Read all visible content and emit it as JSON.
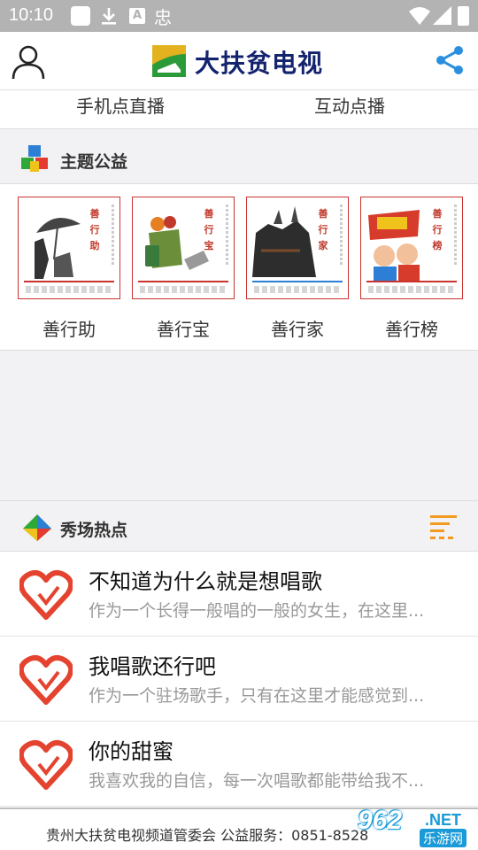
{
  "status_bar": {
    "time": "10:10",
    "badge_letter": "A",
    "app_glyph": "忠"
  },
  "header": {
    "title": "大扶贫电视",
    "accent": "#13236e",
    "share_color": "#2a8fde"
  },
  "tabs": [
    {
      "label": "手机点直播"
    },
    {
      "label": "互动点播"
    }
  ],
  "section_welfare": {
    "title": "主题公益",
    "items": [
      {
        "label": "善行助",
        "card_title": "善行助"
      },
      {
        "label": "善行宝",
        "card_title": "善行宝"
      },
      {
        "label": "善行家",
        "card_title": "善行家"
      },
      {
        "label": "善行榜",
        "card_title": "善行榜"
      }
    ]
  },
  "section_hot": {
    "title": "秀场热点",
    "items": [
      {
        "title": "不知道为什么就是想唱歌",
        "desc": "作为一个长得一般唱的一般的女生，在这里..."
      },
      {
        "title": "我唱歌还行吧",
        "desc": "作为一个驻场歌手，只有在这里才能感觉到..."
      },
      {
        "title": "你的甜蜜",
        "desc": "我喜欢我的自信，每一次唱歌都能带给我不..."
      }
    ]
  },
  "footer": {
    "text": "贵州大扶贫电视频道管委会 公益服务：0851-8528"
  },
  "watermark": {
    "number": "962",
    "suffix": ".NET",
    "sub": "乐游网"
  }
}
